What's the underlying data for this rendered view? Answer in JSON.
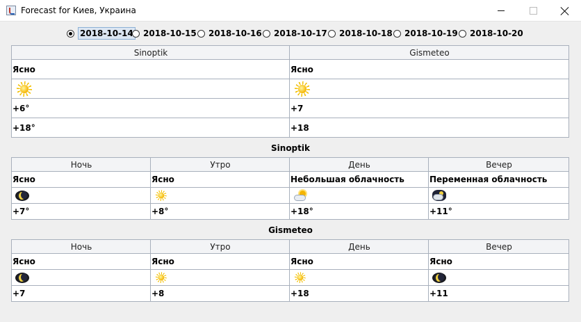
{
  "window": {
    "title": "Forecast for Киев, Украина"
  },
  "dates": [
    {
      "label": "2018-10-14",
      "selected": true
    },
    {
      "label": "2018-10-15",
      "selected": false
    },
    {
      "label": "2018-10-16",
      "selected": false
    },
    {
      "label": "2018-10-17",
      "selected": false
    },
    {
      "label": "2018-10-18",
      "selected": false
    },
    {
      "label": "2018-10-19",
      "selected": false
    },
    {
      "label": "2018-10-20",
      "selected": false
    }
  ],
  "summary": {
    "columns": [
      {
        "source": "Sinoptik",
        "condition": "Ясно",
        "icon": "sun-icon",
        "low": "+6°",
        "high": "+18°"
      },
      {
        "source": "Gismeteo",
        "condition": "Ясно",
        "icon": "sun-icon",
        "low": "+7",
        "high": "+18"
      }
    ]
  },
  "sinoptik": {
    "title": "Sinoptik",
    "periods": [
      {
        "name": "Ночь",
        "condition": "Ясно",
        "icon": "moon-icon",
        "temp": "+7°"
      },
      {
        "name": "Утро",
        "condition": "Ясно",
        "icon": "sun-icon",
        "temp": "+8°"
      },
      {
        "name": "День",
        "condition": "Небольшая облачность",
        "icon": "partly-cloudy-icon",
        "temp": "+18°"
      },
      {
        "name": "Вечер",
        "condition": "Переменная облачность",
        "icon": "night-cloudy-icon",
        "temp": "+11°"
      }
    ]
  },
  "gismeteo": {
    "title": "Gismeteo",
    "periods": [
      {
        "name": "Ночь",
        "condition": "Ясно",
        "icon": "moon-icon",
        "temp": "+7"
      },
      {
        "name": "Утро",
        "condition": "Ясно",
        "icon": "sun-icon",
        "temp": "+8"
      },
      {
        "name": "День",
        "condition": "Ясно",
        "icon": "sun-icon",
        "temp": "+18"
      },
      {
        "name": "Вечер",
        "condition": "Ясно",
        "icon": "moon-icon",
        "temp": "+11"
      }
    ]
  }
}
